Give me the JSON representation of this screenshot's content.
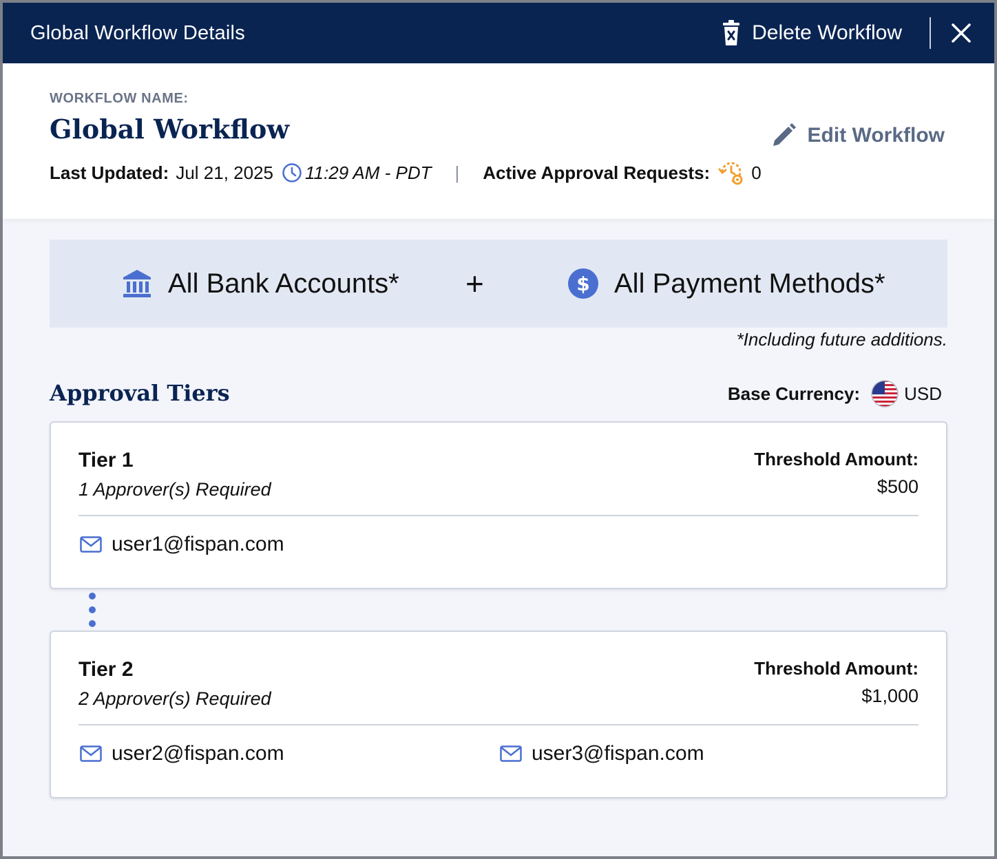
{
  "header": {
    "title": "Global Workflow Details",
    "delete_label": "Delete Workflow",
    "close_icon": "close-icon"
  },
  "info": {
    "name_label": "WORKFLOW NAME:",
    "name": "Global Workflow",
    "edit_label": "Edit Workflow",
    "last_updated_label": "Last Updated:",
    "last_updated_date": "Jul 21, 2025",
    "last_updated_time": "11:29 AM - PDT",
    "separator": "|",
    "active_requests_label": "Active Approval Requests:",
    "active_requests_count": "0"
  },
  "scope": {
    "bank_label": "All Bank Accounts*",
    "plus": "+",
    "payment_label": "All Payment Methods*",
    "footnote": "*Including future additions."
  },
  "tiers_section": {
    "title": "Approval Tiers",
    "base_currency_label": "Base Currency:",
    "base_currency": "USD"
  },
  "tiers": [
    {
      "name": "Tier 1",
      "required": "1 Approver(s) Required",
      "threshold_label": "Threshold Amount:",
      "threshold": "$500",
      "users": [
        "user1@fispan.com"
      ]
    },
    {
      "name": "Tier 2",
      "required": "2 Approver(s) Required",
      "threshold_label": "Threshold Amount:",
      "threshold": "$1,000",
      "users": [
        "user2@fispan.com",
        "user3@fispan.com"
      ]
    }
  ],
  "colors": {
    "header_bg": "#0a2452",
    "accent_blue": "#4a6fd0",
    "warning_orange": "#f0a030",
    "banner_bg": "#e2e8f3"
  }
}
